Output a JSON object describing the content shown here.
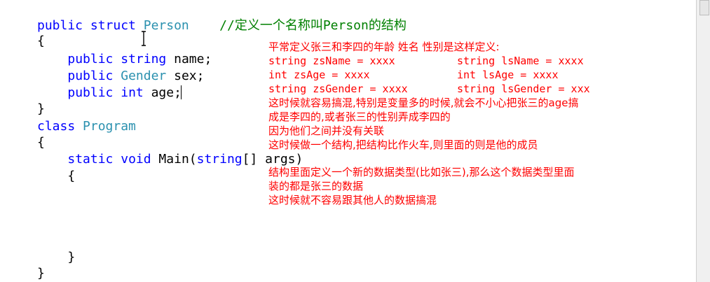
{
  "code": {
    "line1": {
      "a": "public",
      "b": " ",
      "c": "struct",
      "d": " ",
      "e": "Person",
      "f": "    ",
      "g": "//定义一个名称叫Person的结构"
    },
    "line2": "{",
    "line3": {
      "a": "    ",
      "b": "public",
      "c": " ",
      "d": "string",
      "e": " name;"
    },
    "line4": {
      "a": "    ",
      "b": "public",
      "c": " ",
      "d": "Gender",
      "e": " sex;"
    },
    "line5": {
      "a": "    ",
      "b": "public",
      "c": " ",
      "d": "int",
      "e": " age;"
    },
    "line6": "}",
    "line7": {
      "a": "class",
      "b": " ",
      "c": "Program"
    },
    "line8": "{",
    "line9": {
      "a": "    ",
      "b": "static",
      "c": " ",
      "d": "void",
      "e": " Main(",
      "f": "string",
      "g": "[] args)"
    },
    "line10": "    {",
    "line11": "    }",
    "line12": "}"
  },
  "notes": {
    "n1": "平常定义张三和李四的年龄 姓名 性别是这样定义:",
    "n2a": "string zsName = xxxx",
    "n2b": "string lsName = xxxx",
    "n3a": "int zsAge = xxxx",
    "n3b": "int lsAge = xxxx",
    "n4a": "string zsGender = xxxx",
    "n4b": "string lsGender = xxx",
    "n5": "这时候就容易搞混,特别是变量多的时候,就会不小心把张三的age搞",
    "n6": "成是李四的,或者张三的性别弄成李四的",
    "n7": "因为他们之间并没有关联",
    "n8": "这时候做一个结构,把结构比作火车,则里面的则是他的成员",
    "n9": "结构里面定义一个新的数据类型(比如张三),那么这个数据类型里面",
    "n10": "装的都是张三的数据",
    "n11": "这时候就不容易跟其他人的数据搞混"
  },
  "colors": {
    "keyword": "#0000ff",
    "type": "#2b91af",
    "comment": "#008000",
    "note": "#ff0000"
  }
}
